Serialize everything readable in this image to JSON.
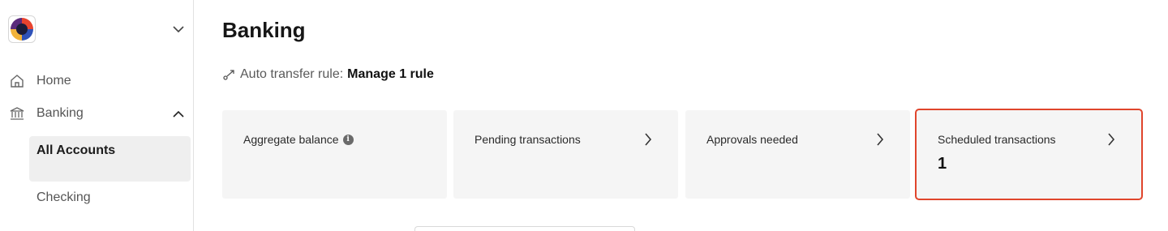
{
  "sidebar": {
    "org_menu_icon": "chevron-down-icon",
    "items": [
      {
        "label": "Home",
        "icon": "home-icon"
      },
      {
        "label": "Banking",
        "icon": "bank-icon",
        "expanded": true
      }
    ],
    "sub_items": [
      {
        "label": "All Accounts",
        "active": true
      },
      {
        "label": "Checking",
        "active": false
      }
    ]
  },
  "main": {
    "title": "Banking",
    "auto_transfer": {
      "label": "Auto transfer rule:",
      "link": "Manage 1 rule",
      "icon": "transfer-arrow-icon"
    },
    "cards": [
      {
        "title": "Aggregate balance",
        "has_info": true,
        "value": "",
        "has_arrow": false
      },
      {
        "title": "Pending transactions",
        "has_arrow": true,
        "value": ""
      },
      {
        "title": "Approvals needed",
        "has_arrow": true,
        "value": ""
      },
      {
        "title": "Scheduled transactions",
        "has_arrow": true,
        "value": "1",
        "highlighted": true
      }
    ]
  },
  "colors": {
    "highlight_outline": "#e0452c",
    "card_background": "#f5f5f5",
    "active_nav_background": "#efefef"
  }
}
